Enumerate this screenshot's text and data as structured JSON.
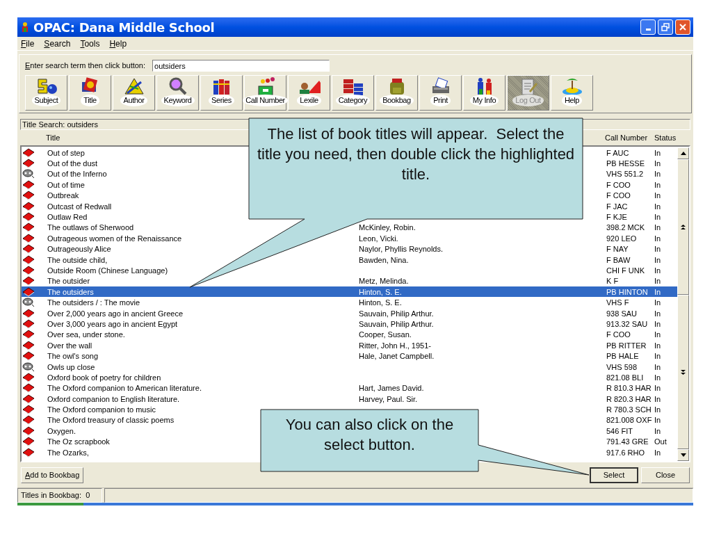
{
  "window": {
    "title": "OPAC: Dana Middle School"
  },
  "menu": [
    "File",
    "Search",
    "Tools",
    "Help"
  ],
  "search": {
    "label": "Enter search term then click button:",
    "value": "outsiders"
  },
  "toolbar": [
    {
      "label": "Subject",
      "kind": "subject",
      "disabled": false
    },
    {
      "label": "Title",
      "kind": "title",
      "disabled": false
    },
    {
      "label": "Author",
      "kind": "author",
      "disabled": false
    },
    {
      "label": "Keyword",
      "kind": "keyword",
      "disabled": false
    },
    {
      "label": "Series",
      "kind": "series",
      "disabled": false
    },
    {
      "label": "Call Number",
      "kind": "callnumber",
      "disabled": false
    },
    {
      "label": "Lexile",
      "kind": "lexile",
      "disabled": false
    },
    {
      "label": "Category",
      "kind": "category",
      "disabled": false
    },
    {
      "label": "Bookbag",
      "kind": "bookbag",
      "disabled": false
    },
    {
      "label": "Print",
      "kind": "print",
      "disabled": false
    },
    {
      "label": "My Info",
      "kind": "myinfo",
      "disabled": false
    },
    {
      "label": "Log Out",
      "kind": "logout",
      "disabled": true
    },
    {
      "label": "Help",
      "kind": "help",
      "disabled": false
    }
  ],
  "results_label": "Title Search: outsiders",
  "columns": [
    "Title",
    "Call Number",
    "Status"
  ],
  "rows": [
    {
      "kind": "book",
      "title": "Out of step",
      "call_number": "F AUC",
      "status": "In",
      "selected": false
    },
    {
      "kind": "book",
      "title": "Out of the dust",
      "call_number": "PB HESSE",
      "status": "In",
      "selected": false
    },
    {
      "kind": "video",
      "title": "Out of the Inferno",
      "call_number": "VHS 551.2",
      "status": "In",
      "selected": false
    },
    {
      "kind": "book",
      "title": "Out of time",
      "call_number": "F COO",
      "status": "In",
      "selected": false
    },
    {
      "kind": "book",
      "title": "Outbreak",
      "call_number": "F COO",
      "status": "In",
      "selected": false
    },
    {
      "kind": "book",
      "title": "Outcast of Redwall",
      "call_number": "F JAC",
      "status": "In",
      "selected": false
    },
    {
      "kind": "book",
      "title": "Outlaw Red",
      "call_number": "F KJE",
      "status": "In",
      "selected": false
    },
    {
      "kind": "book",
      "title": "The outlaws of Sherwood",
      "author": "McKinley, Robin.",
      "call_number": "398.2 MCK",
      "status": "In",
      "selected": false
    },
    {
      "kind": "book",
      "title": "Outrageous women of the Renaissance",
      "author": "Leon, Vicki.",
      "call_number": "920 LEO",
      "status": "In",
      "selected": false
    },
    {
      "kind": "book",
      "title": "Outrageously Alice",
      "author": "Naylor, Phyllis Reynolds.",
      "call_number": "F NAY",
      "status": "In",
      "selected": false
    },
    {
      "kind": "book",
      "title": "The outside child,",
      "author": "Bawden, Nina.",
      "call_number": "F BAW",
      "status": "In",
      "selected": false
    },
    {
      "kind": "book",
      "title": "Outside Room (Chinese Language)",
      "call_number": "CHI F UNK",
      "status": "In",
      "selected": false
    },
    {
      "kind": "book",
      "title": "The outsider",
      "author": "Metz, Melinda.",
      "call_number": "K F",
      "status": "In",
      "selected": false
    },
    {
      "kind": "book",
      "title": "The outsiders",
      "author": "Hinton, S. E.",
      "call_number": "PB HINTON",
      "status": "In",
      "selected": true
    },
    {
      "kind": "video",
      "title": "The outsiders / : The movie",
      "author": "Hinton, S. E.",
      "call_number": "VHS F",
      "status": "In",
      "selected": false
    },
    {
      "kind": "book",
      "title": "Over 2,000 years ago in ancient Greece",
      "author": "Sauvain, Philip Arthur.",
      "call_number": "938 SAU",
      "status": "In",
      "selected": false
    },
    {
      "kind": "book",
      "title": "Over 3,000 years ago in ancient Egypt",
      "author": "Sauvain, Philip Arthur.",
      "call_number": "913.32 SAU",
      "status": "In",
      "selected": false
    },
    {
      "kind": "book",
      "title": "Over sea, under stone.",
      "author": "Cooper, Susan.",
      "call_number": "F COO",
      "status": "In",
      "selected": false
    },
    {
      "kind": "book",
      "title": "Over the wall",
      "author": "Ritter, John H., 1951-",
      "call_number": "PB RITTER",
      "status": "In",
      "selected": false
    },
    {
      "kind": "book",
      "title": "The owl's song",
      "author": "Hale, Janet Campbell.",
      "call_number": "PB HALE",
      "status": "In",
      "selected": false
    },
    {
      "kind": "video",
      "title": "Owls up close",
      "call_number": "VHS 598",
      "status": "In",
      "selected": false
    },
    {
      "kind": "book",
      "title": "Oxford book of poetry for children",
      "call_number": "821.08 BLI",
      "status": "In",
      "selected": false
    },
    {
      "kind": "book",
      "title": "The Oxford companion to American literature.",
      "author": "Hart, James David.",
      "call_number": "R 810.3 HAR",
      "status": "In",
      "selected": false
    },
    {
      "kind": "book",
      "title": "Oxford companion to English literature.",
      "author": "Harvey, Paul. Sir.",
      "call_number": "R 820.3 HAR",
      "status": "In",
      "selected": false
    },
    {
      "kind": "book",
      "title": "The Oxford companion to music",
      "call_number": "R 780.3 SCH",
      "status": "In",
      "selected": false
    },
    {
      "kind": "book",
      "title": "The Oxford treasury of classic poems",
      "call_number": "821.008 OXF",
      "status": "In",
      "selected": false
    },
    {
      "kind": "book",
      "title": "Oxygen.",
      "call_number": "546 FIT",
      "status": "In",
      "selected": false
    },
    {
      "kind": "book",
      "title": "The Oz scrapbook",
      "call_number": "791.43 GRE",
      "status": "Out",
      "selected": false
    },
    {
      "kind": "book",
      "title": "The Ozarks,",
      "call_number": "917.6 RHO",
      "status": "In",
      "selected": false
    }
  ],
  "left_button": "Add to Bookbag",
  "right_buttons": [
    "Select",
    "Close"
  ],
  "status_bar": "Titles in Bookbag:  0",
  "callouts": [
    "The list of book titles will appear.  Select the title you need, then double click the highlighted title.",
    "You can also click on the select button."
  ]
}
